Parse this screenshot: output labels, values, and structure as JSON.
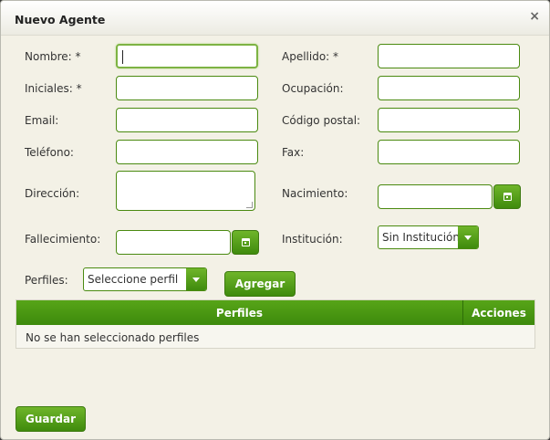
{
  "dialog": {
    "title": "Nuevo Agente",
    "close_glyph": "×"
  },
  "form": {
    "nombre_label": "Nombre: *",
    "apellido_label": "Apellido: *",
    "iniciales_label": "Iniciales: *",
    "ocupacion_label": "Ocupación:",
    "email_label": "Email:",
    "codigo_postal_label": "Código postal:",
    "telefono_label": "Teléfono:",
    "fax_label": "Fax:",
    "direccion_label": "Dirección:",
    "nacimiento_label": "Nacimiento:",
    "fallecimiento_label": "Fallecimiento:",
    "institucion_label": "Institución:",
    "institucion_value": "Sin Institución",
    "perfiles_label": "Perfiles:",
    "perfiles_value": "Seleccione perfil"
  },
  "buttons": {
    "agregar": "Agregar",
    "guardar": "Guardar"
  },
  "table": {
    "headers": [
      "Perfiles",
      "Acciones"
    ],
    "empty_message": "No se han seleccionado perfiles"
  },
  "colors": {
    "accent": "#4a9a12",
    "background": "#f3f1e6"
  }
}
